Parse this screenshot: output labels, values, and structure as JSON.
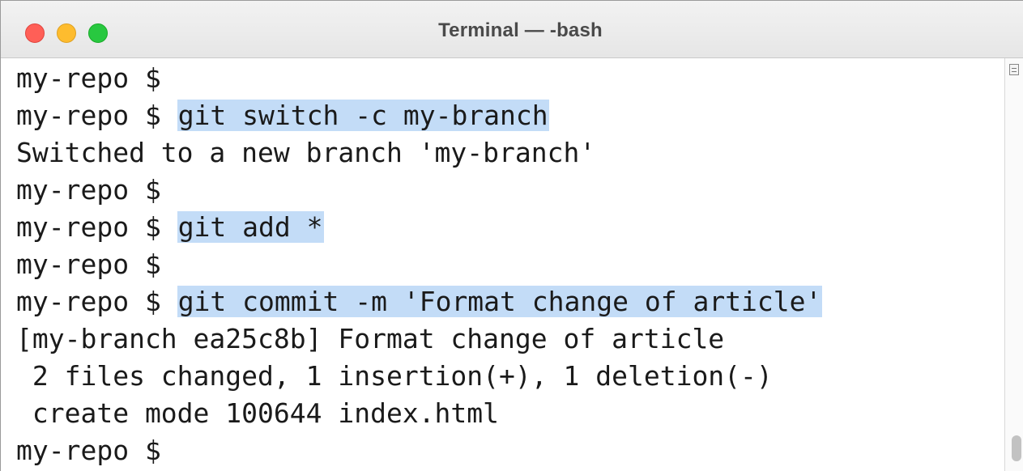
{
  "window": {
    "title": "Terminal — -bash"
  },
  "terminal": {
    "lines": [
      {
        "prompt": "my-repo $",
        "command": ""
      },
      {
        "prompt": "my-repo $ ",
        "command": "git switch -c my-branch"
      },
      {
        "output": "Switched to a new branch 'my-branch'"
      },
      {
        "prompt": "my-repo $",
        "command": ""
      },
      {
        "prompt": "my-repo $ ",
        "command": "git add *"
      },
      {
        "prompt": "my-repo $",
        "command": ""
      },
      {
        "prompt": "my-repo $ ",
        "command": "git commit -m 'Format change of article'"
      },
      {
        "output": "[my-branch ea25c8b] Format change of article"
      },
      {
        "output": " 2 files changed, 1 insertion(+), 1 deletion(-)"
      },
      {
        "output": " create mode 100644 index.html"
      },
      {
        "prompt": "my-repo $",
        "command": ""
      }
    ]
  },
  "colors": {
    "selection_highlight": "#c3dcf7",
    "close": "#ff5f57",
    "minimize": "#febc2e",
    "zoom": "#28c840"
  },
  "icons": {
    "close": "close-button-icon",
    "minimize": "minimize-button-icon",
    "zoom": "zoom-button-icon",
    "split": "split-pane-icon"
  }
}
